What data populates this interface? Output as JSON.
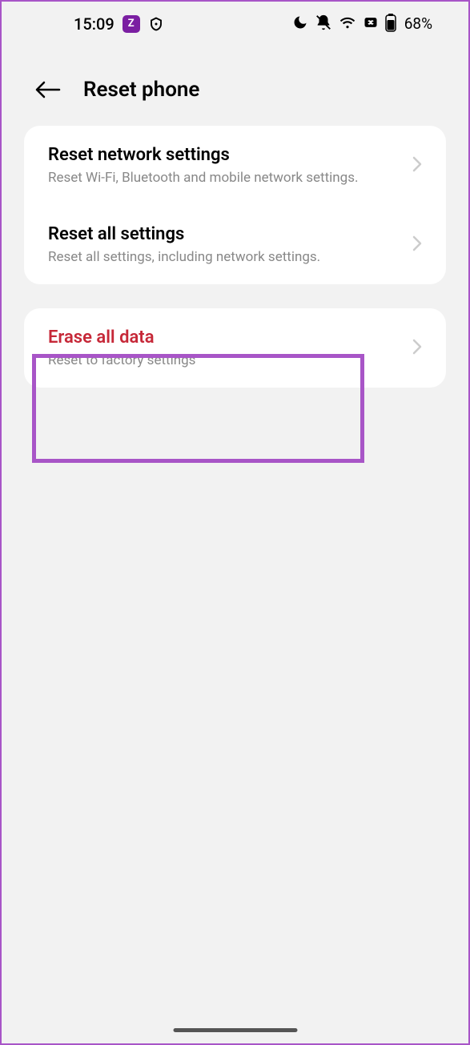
{
  "statusBar": {
    "time": "15:09",
    "zLabel": "Z",
    "batteryPercent": "68%"
  },
  "header": {
    "title": "Reset phone"
  },
  "section1": {
    "items": [
      {
        "title": "Reset network settings",
        "subtitle": "Reset Wi-Fi, Bluetooth and mobile network settings."
      },
      {
        "title": "Reset all settings",
        "subtitle": "Reset all settings, including network settings."
      }
    ]
  },
  "section2": {
    "items": [
      {
        "title": "Erase all data",
        "subtitle": "Reset to factory settings"
      }
    ]
  }
}
